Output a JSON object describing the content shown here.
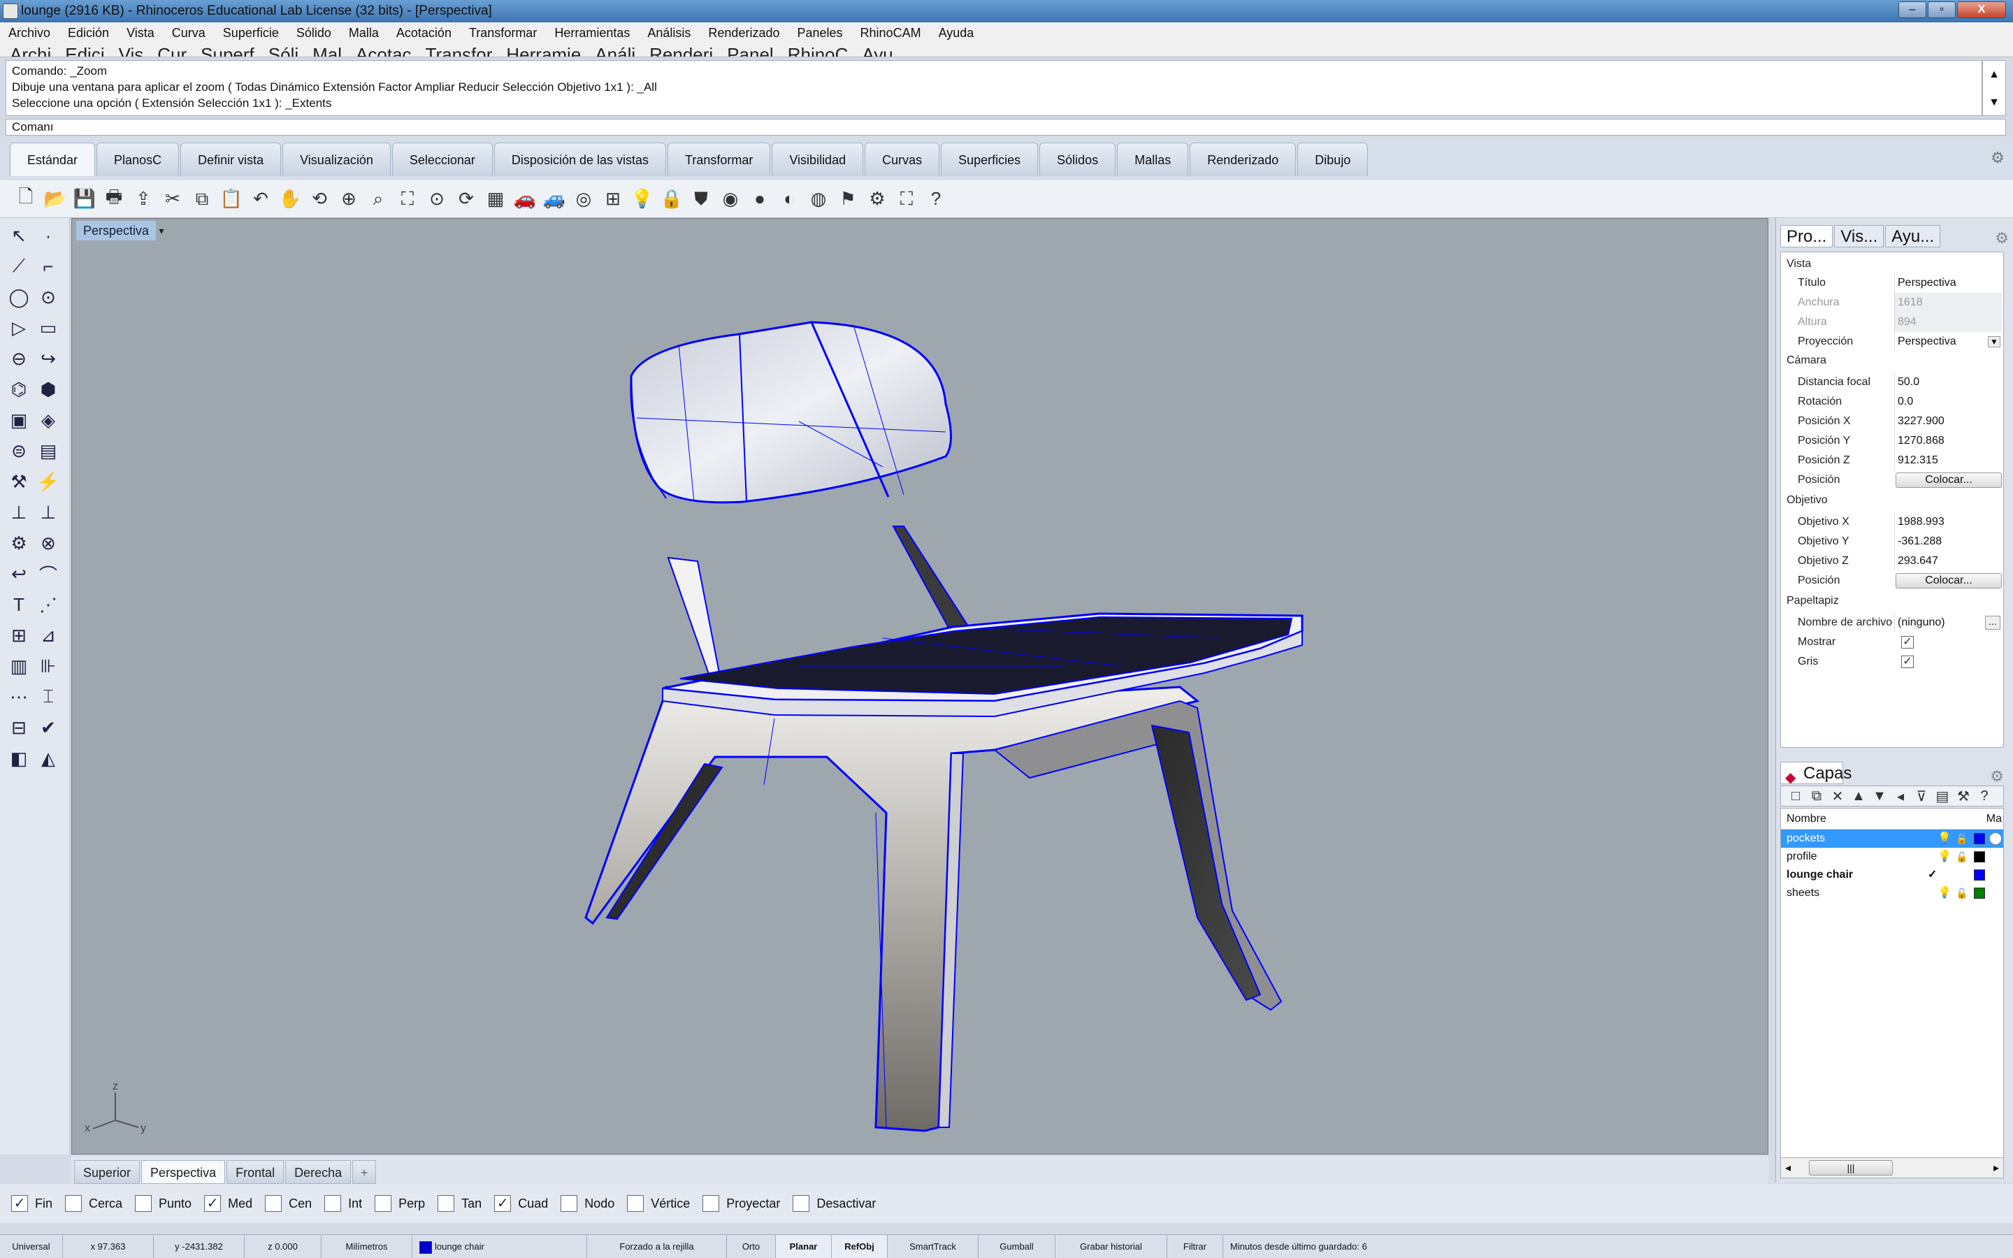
{
  "window": {
    "title": "lounge (2916 KB) - Rhinoceros Educational Lab License (32 bits) - [Perspectiva]",
    "buttons": [
      "–",
      "▫",
      "X"
    ]
  },
  "menu": [
    "Archivo",
    "Edición",
    "Vista",
    "Curva",
    "Superficie",
    "Sólido",
    "Malla",
    "Acotación",
    "Transformar",
    "Herramientas",
    "Análisis",
    "Renderizado",
    "Paneles",
    "RhinoCAM",
    "Ayuda"
  ],
  "menu_ghost": [
    "Archi",
    "Edici",
    "Vis",
    "Cur",
    "Superf",
    "Sóli",
    "Mal",
    "Acotac",
    "Transfor",
    "Herramie",
    "Análi",
    "Renderi",
    "Panel",
    "RhinoC",
    "Ayu"
  ],
  "command": {
    "history": [
      "Comando: _Zoom",
      "Dibuje una ventana para aplicar el zoom ( Todas  Dinámico  Extensión  Factor  Ampliar  Reducir  Selección  Objetivo  1x1 ): _All",
      "Seleccione una opción ( Extensión  Selección  1x1 ): _Extents"
    ],
    "prompt": "Comanı"
  },
  "tabs": [
    "Estándar",
    "PlanosC",
    "Definir vista",
    "Visualización",
    "Seleccionar",
    "Disposición de las vistas",
    "Transformar",
    "Visibilidad",
    "Curvas",
    "Superficies",
    "Sólidos",
    "Mallas",
    "Renderizado",
    "Dibujo"
  ],
  "active_tab": "Estándar",
  "toolbar_icons": [
    "new-icon",
    "open-icon",
    "save-icon",
    "print-icon",
    "import-icon",
    "cut-icon",
    "copy-icon",
    "paste-icon",
    "undo-icon",
    "pan-icon",
    "rotate-view-icon",
    "zoom-icon",
    "zoom-window-icon",
    "zoom-extents-icon",
    "zoom-selected-icon",
    "rotate-icon",
    "grid-icon",
    "car-icon",
    "car2-icon",
    "target-icon",
    "layer-icon",
    "light-icon",
    "lock-icon",
    "shield-icon",
    "color-wheel-icon",
    "sphere-icon",
    "render-sphere-icon",
    "blue-sphere-icon",
    "flag-icon",
    "gear-icon",
    "crop-icon",
    "help-icon"
  ],
  "viewport": {
    "label": "Perspectiva",
    "dropdown": "▾",
    "axes": {
      "x": "x",
      "y": "y",
      "z": "z"
    }
  },
  "view_tabs": [
    "Superior",
    "Perspectiva",
    "Frontal",
    "Derecha"
  ],
  "active_view": "Perspectiva",
  "view_add": "+",
  "properties": {
    "tabs": [
      "Pro...",
      "Vis...",
      "Ayu..."
    ],
    "sections": {
      "vista": "Vista",
      "camara": "Cámara",
      "objetivo": "Objetivo",
      "papeltapiz": "Papeltapiz"
    },
    "rows": {
      "titulo": {
        "label": "Título",
        "value": "Perspectiva"
      },
      "anchura": {
        "label": "Anchura",
        "value": "1618"
      },
      "altura": {
        "label": "Altura",
        "value": "894"
      },
      "proyeccion": {
        "label": "Proyección",
        "value": "Perspectiva"
      },
      "distancia": {
        "label": "Distancia focal",
        "value": "50.0"
      },
      "rotacion": {
        "label": "Rotación",
        "value": "0.0"
      },
      "posx": {
        "label": "Posición X",
        "value": "3227.900"
      },
      "posy": {
        "label": "Posición Y",
        "value": "1270.868"
      },
      "posz": {
        "label": "Posición Z",
        "value": "912.315"
      },
      "posicion": {
        "label": "Posición",
        "button": "Colocar..."
      },
      "objx": {
        "label": "Objetivo X",
        "value": "1988.993"
      },
      "objy": {
        "label": "Objetivo Y",
        "value": "-361.288"
      },
      "objz": {
        "label": "Objetivo Z",
        "value": "293.647"
      },
      "objpos": {
        "label": "Posición",
        "button": "Colocar..."
      },
      "archivo": {
        "label": "Nombre de archivo",
        "value": "(ninguno)",
        "dots": "..."
      },
      "mostrar": {
        "label": "Mostrar",
        "checked": "✓"
      },
      "gris": {
        "label": "Gris",
        "checked": "✓"
      }
    }
  },
  "layers": {
    "title": "Capas",
    "header": "Nombre",
    "header_mat": "Ma",
    "items": [
      {
        "name": "pockets",
        "color": "#ff0000",
        "selected": true
      },
      {
        "name": "profile",
        "color": "#000000"
      },
      {
        "name": "lounge chair",
        "color": "#0000ff",
        "current": true,
        "check": "✓"
      },
      {
        "name": "sheets",
        "color": "#008000"
      }
    ],
    "scroll": {
      "left": "◂",
      "thumb": "|||",
      "right": "▸"
    }
  },
  "osnaps": [
    {
      "label": "Fin",
      "checked": true
    },
    {
      "label": "Cerca",
      "checked": false
    },
    {
      "label": "Punto",
      "checked": false
    },
    {
      "label": "Med",
      "checked": true
    },
    {
      "label": "Cen",
      "checked": false
    },
    {
      "label": "Int",
      "checked": false
    },
    {
      "label": "Perp",
      "checked": false
    },
    {
      "label": "Tan",
      "checked": false
    },
    {
      "label": "Cuad",
      "checked": true
    },
    {
      "label": "Nodo",
      "checked": false
    },
    {
      "label": "Vértice",
      "checked": false
    },
    {
      "label": "Proyectar",
      "checked": false
    },
    {
      "label": "Desactivar",
      "checked": false
    }
  ],
  "check_glyph": "✓",
  "status": {
    "cplane": "Universal",
    "x": "x 97.363",
    "y": "y -2431.382",
    "z": "z 0.000",
    "units": "Milímetros",
    "layer": "lounge chair",
    "grid_snap": "Forzado a la rejilla",
    "ortho": "Orto",
    "planar": "Planar",
    "osnap": "RefObj",
    "smarttrack": "SmartTrack",
    "gumball": "Gumball",
    "history": "Grabar historial",
    "filter": "Filtrar",
    "autosave": "Minutos desde último guardado: 6"
  },
  "colors": {
    "accent": "#0000ff",
    "seat": "#1a1a2e",
    "selection": "#3399ff"
  }
}
